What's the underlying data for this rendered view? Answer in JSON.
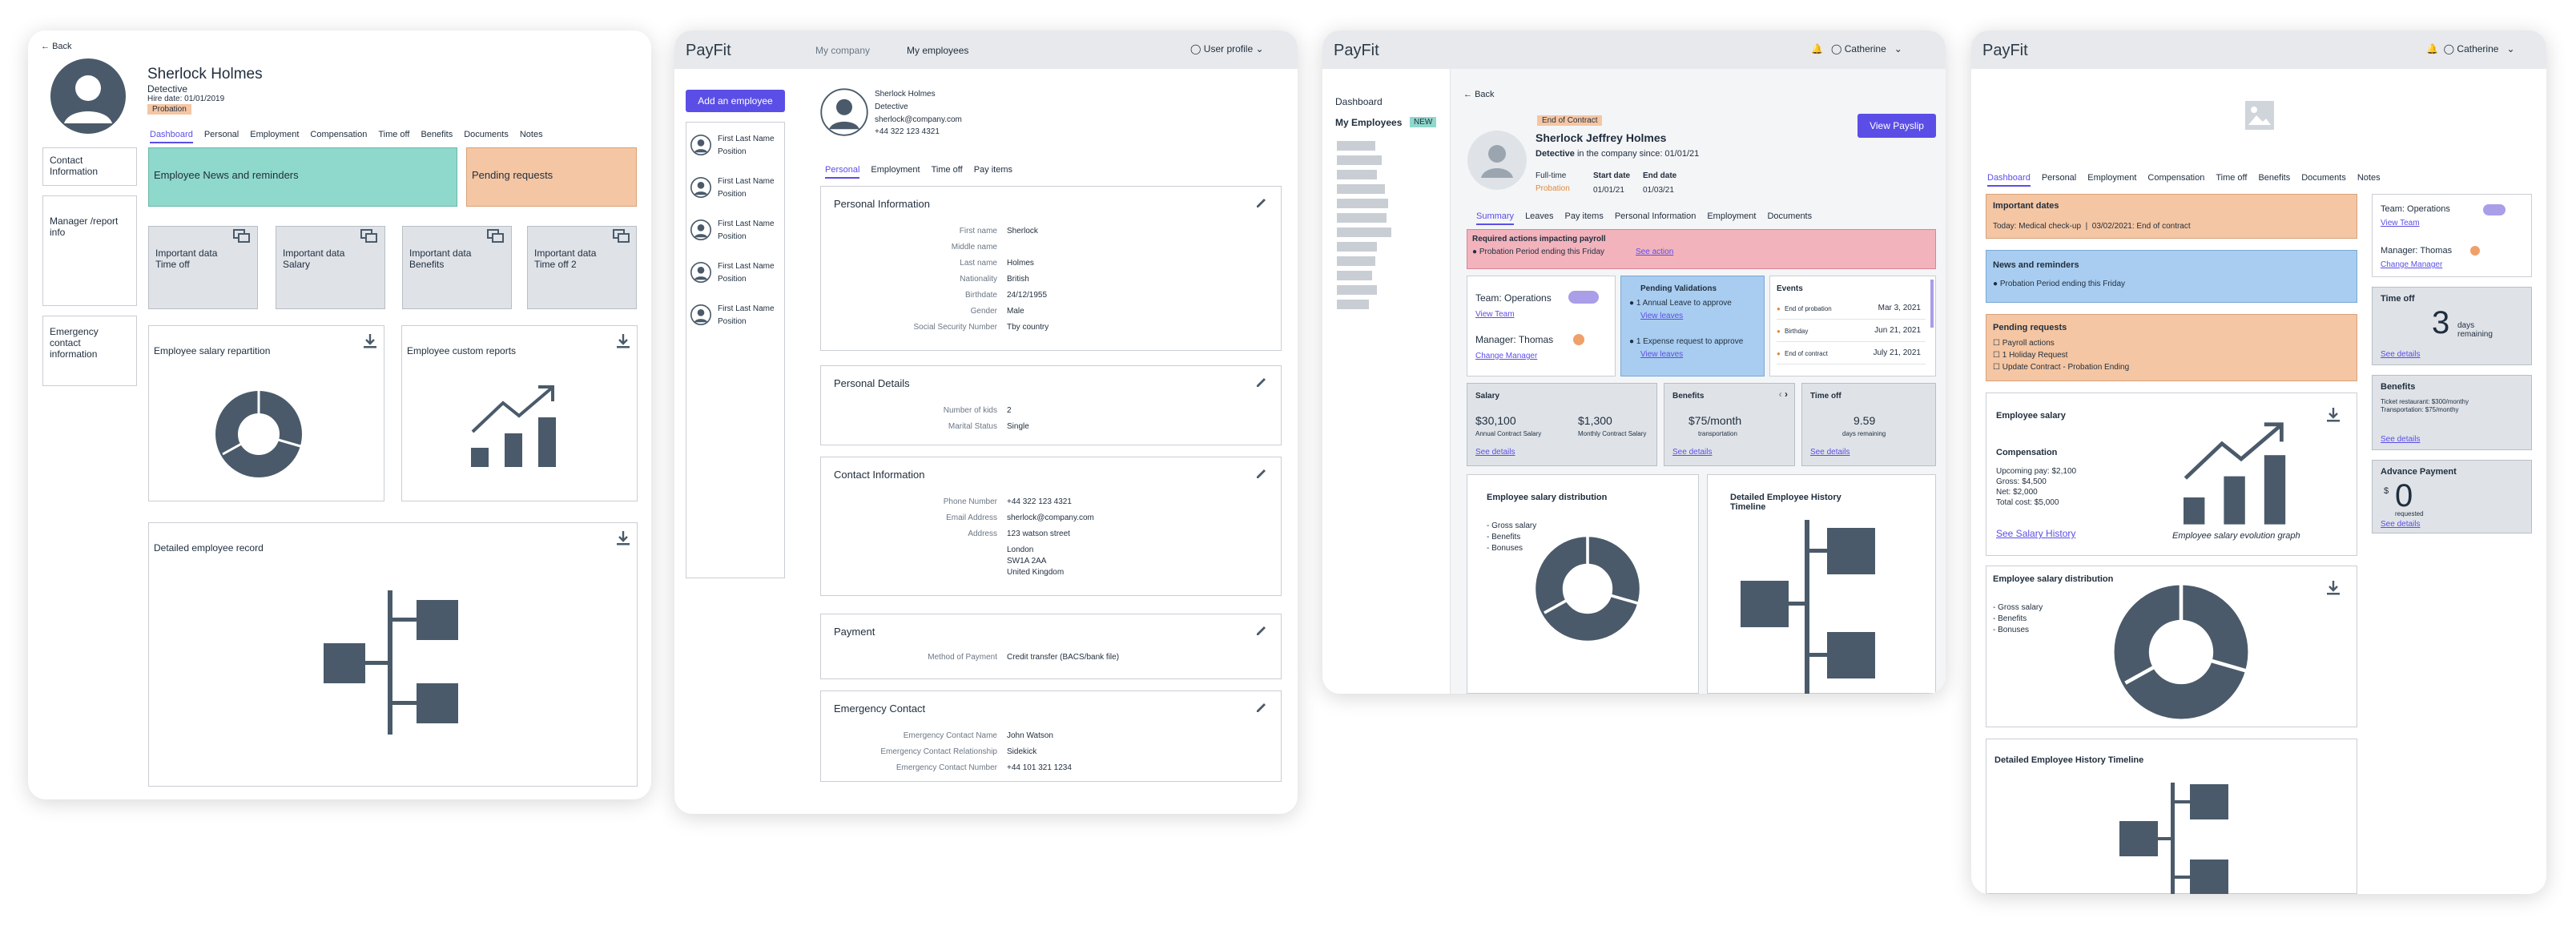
{
  "colors": {
    "accent": "#5b4ee6",
    "teal": "#8fd8cc",
    "peach": "#f5c6a3",
    "blue": "#a9cdf0",
    "pink": "#f2b3bd",
    "icon": "#4a5a6a",
    "warn": "#e08a3c"
  },
  "f1": {
    "back": "Back",
    "name": "Sherlock Holmes",
    "role": "Detective",
    "hire": "Hire date: 01/01/2019",
    "badge": "Probation",
    "tabs": [
      "Dashboard",
      "Personal",
      "Employment",
      "Compensation",
      "Time off",
      "Benefits",
      "Documents",
      "Notes"
    ],
    "side": [
      "Contact Information",
      "Manager /report info",
      "Emergency contact information"
    ],
    "news": "Employee News and reminders",
    "pending": "Pending requests",
    "imp": [
      {
        "a": "Important data",
        "b": "Time off"
      },
      {
        "a": "Important data",
        "b": "Salary"
      },
      {
        "a": "Important data",
        "b": "Benefits"
      },
      {
        "a": "Important data",
        "b": "Time off 2"
      }
    ],
    "salary": "Employee salary repartition",
    "reports": "Employee custom reports",
    "record": "Detailed employee record"
  },
  "f2": {
    "logo": "PayFit",
    "nav1": "My company",
    "nav2": "My employees",
    "profile": "User profile",
    "add": "Add an employee",
    "list": [
      {
        "n": "First Last Name",
        "p": "Position"
      },
      {
        "n": "First Last Name",
        "p": "Position"
      },
      {
        "n": "First Last Name",
        "p": "Position"
      },
      {
        "n": "First Last Name",
        "p": "Position"
      },
      {
        "n": "First Last Name",
        "p": "Position"
      }
    ],
    "name": "Sherlock Holmes",
    "role": "Detective",
    "email": "sherlock@company.com",
    "phone": "+44 322 123 4321",
    "tabs": [
      "Personal",
      "Employment",
      "Time off",
      "Pay items"
    ],
    "pi": {
      "title": "Personal Information",
      "rows": [
        [
          "First name",
          "Sherlock"
        ],
        [
          "Middle name",
          ""
        ],
        [
          "Last name",
          "Holmes"
        ],
        [
          "Nationality",
          "British"
        ],
        [
          "Birthdate",
          "24/12/1955"
        ],
        [
          "Gender",
          "Male"
        ],
        [
          "Social Security Number",
          "Tby country"
        ]
      ]
    },
    "pd": {
      "title": "Personal Details",
      "rows": [
        [
          "Number of kids",
          "2"
        ],
        [
          "Marital Status",
          "Single"
        ]
      ]
    },
    "ci": {
      "title": "Contact Information",
      "rows": [
        [
          "Phone Number",
          "+44 322 123 4321"
        ],
        [
          "Email Address",
          "sherlock@company.com"
        ],
        [
          "Address",
          "123 watson street"
        ]
      ],
      "addr": [
        "London",
        "SW1A 2AA",
        "United Kingdom"
      ]
    },
    "pay": {
      "title": "Payment",
      "rows": [
        [
          "Method of Payment",
          "Credit transfer (BACS/bank file)"
        ]
      ]
    },
    "ec": {
      "title": "Emergency Contact",
      "rows": [
        [
          "Emergency Contact Name",
          "John Watson"
        ],
        [
          "Emergency Contact Relationship",
          "Sidekick"
        ],
        [
          "Emergency Contact Number",
          "+44 101 321 1234"
        ]
      ]
    }
  },
  "f3": {
    "logo": "PayFit",
    "user": "Catherine",
    "dash": "Dashboard",
    "myemp": "My Employees",
    "new": "NEW",
    "back": "Back",
    "badge": "End of Contract",
    "name": "Sherlock Jeffrey Holmes",
    "role": "Detective",
    "since": "in the company since: 01/01/21",
    "ft": "Full-time",
    "prob": "Probation",
    "sdl": "Start date",
    "sdv": "01/01/21",
    "edl": "End date",
    "edv": "01/03/21",
    "payslip": "View Payslip",
    "tabs": [
      "Summary",
      "Leaves",
      "Pay items",
      "Personal Information",
      "Employment",
      "Documents"
    ],
    "req": "Required actions impacting payroll",
    "req2": "Probation Period ending this Friday",
    "seeact": "See action",
    "team": "Team: Operations",
    "vteam": "View Team",
    "mgr": "Manager: Thomas",
    "cmgr": "Change Manager",
    "pv": "Pending Validations",
    "pv1": "1 Annual Leave to approve",
    "pv1l": "View leaves",
    "pv2": "1 Expense request to approve",
    "pv2l": "View leaves",
    "ev": "Events",
    "events": [
      [
        "End of probation",
        "Mar 3, 2021"
      ],
      [
        "Birthday",
        "Jun 21, 2021"
      ],
      [
        "End of contract",
        "July 21, 2021"
      ]
    ],
    "sal": "Salary",
    "s1": "$30,100",
    "s1l": "Annual Contract Salary",
    "s2": "$1,300",
    "s2l": "Monthly Contract Salary",
    "sd": "See details",
    "ben": "Benefits",
    "bv": "$75/month",
    "bl": "transportation",
    "to": "Time off",
    "tv": "9.59",
    "tl": "days remaining",
    "dist": "Employee salary distribution",
    "legend": [
      "- Gross salary",
      "- Benefits",
      "- Bonuses"
    ],
    "hist": "Detailed Employee History Timeline"
  },
  "f4": {
    "logo": "PayFit",
    "user": "Catherine",
    "tabs": [
      "Dashboard",
      "Personal",
      "Employment",
      "Compensation",
      "Time off",
      "Benefits",
      "Documents",
      "Notes"
    ],
    "impd": "Important dates",
    "impd1": "Today: Medical check-up",
    "impd2": "03/02/2021: End of contract",
    "news": "News and reminders",
    "news1": "Probation Period ending this Friday",
    "pend": "Pending requests",
    "pend1": "Payroll actions",
    "pend2": "1 Holiday Request",
    "pend3": "Update Contract - Probation Ending",
    "es": "Employee salary",
    "comp": "Compensation",
    "lines": [
      "Upcoming pay: $2,100",
      "Gross: $4,500",
      "Net: $2,000",
      "Total cost: $5,000"
    ],
    "seesh": "See Salary History",
    "evo": "Employee salary evolution graph",
    "dist": "Employee salary distribution",
    "legend": [
      "- Gross salary",
      "- Benefits",
      "- Bonuses"
    ],
    "hist": "Detailed Employee History Timeline",
    "team": "Team: Operations",
    "vteam": "View Team",
    "mgr": "Manager: Thomas",
    "cmgr": "Change Manager",
    "to": "Time off",
    "tv": "3",
    "tl": "days remaining",
    "sd": "See details",
    "ben": "Benefits",
    "ben1": "Ticket restaurant: $300/monthy",
    "ben2": "Transportation: $75/monthy",
    "adv": "Advance Payment",
    "cur": "$",
    "av": "0",
    "al": "requested"
  }
}
